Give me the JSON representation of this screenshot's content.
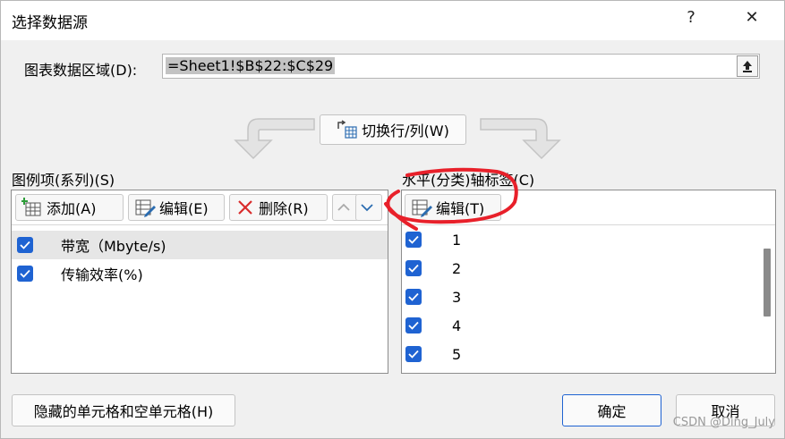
{
  "dialog": {
    "title": "选择数据源",
    "help_label": "?",
    "close_label": "✕"
  },
  "range": {
    "label": "图表数据区域(D):",
    "value": "=Sheet1!$B$22:$C$29"
  },
  "switch_button": {
    "label": "切换行/列(W)"
  },
  "legend": {
    "heading": "图例项(系列)(S)",
    "add_label": "添加(A)",
    "edit_label": "编辑(E)",
    "delete_label": "删除(R)",
    "items": [
      {
        "label": "带宽（Mbyte/s)",
        "checked": true,
        "selected": true
      },
      {
        "label": "传输效率(%)",
        "checked": true,
        "selected": false
      }
    ]
  },
  "axis": {
    "heading": "水平(分类)轴标签(C)",
    "edit_label": "编辑(T)",
    "items": [
      {
        "label": "1",
        "checked": true
      },
      {
        "label": "2",
        "checked": true
      },
      {
        "label": "3",
        "checked": true
      },
      {
        "label": "4",
        "checked": true
      },
      {
        "label": "5",
        "checked": true
      }
    ]
  },
  "footer": {
    "hidden_cells_label": "隐藏的单元格和空单元格(H)",
    "ok_label": "确定",
    "cancel_label": "取消"
  },
  "watermark": "CSDN @Ding_July",
  "colors": {
    "accent": "#1f63d2",
    "annotation_red": "#e8202a",
    "selection": "#e6e6e6"
  }
}
